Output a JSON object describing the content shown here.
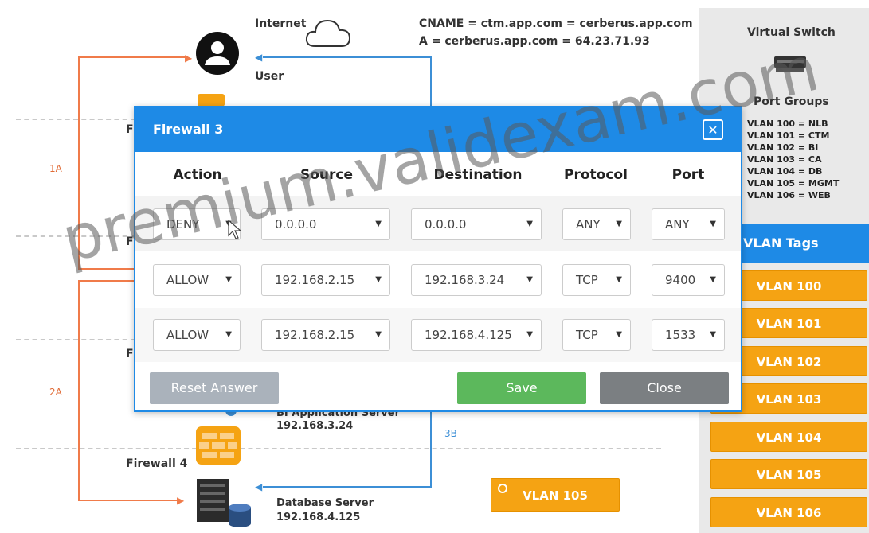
{
  "diagram": {
    "internet_label": "Internet",
    "user_label": "User",
    "cname_line": "CNAME = ctm.app.com = cerberus.app.com",
    "a_line": "A = cerberus.app.com = 64.23.71.93",
    "left_labels": [
      "1A",
      "2A"
    ],
    "partial_fw": [
      "F",
      "F",
      "F"
    ],
    "bi_server_name": "BI Application Server",
    "bi_server_ip": "192.168.3.24",
    "label_3b": "3B",
    "firewall4_label": "Firewall 4",
    "db_server_name": "Database Server",
    "db_server_ip": "192.168.4.125",
    "vlan105_chip": "VLAN 105"
  },
  "right_panel": {
    "title": "Virtual Switch",
    "port_groups_title": "Port Groups",
    "port_groups": [
      "VLAN 100 = NLB",
      "VLAN 101 = CTM",
      "VLAN 102 = BI",
      "VLAN 103 = CA",
      "VLAN 104 = DB",
      "VLAN 105 = MGMT",
      "VLAN 106 = WEB"
    ],
    "tags_header": "VLAN Tags",
    "tags": [
      "VLAN 100",
      "VLAN 101",
      "VLAN 102",
      "VLAN 103",
      "VLAN 104",
      "VLAN 105",
      "VLAN 106"
    ]
  },
  "modal": {
    "title": "Firewall 3",
    "close_x": "✕",
    "columns": [
      "Action",
      "Source",
      "Destination",
      "Protocol",
      "Port"
    ],
    "rows": [
      {
        "action": "DENY",
        "source": "0.0.0.0",
        "destination": "0.0.0.0",
        "protocol": "ANY",
        "port": "ANY"
      },
      {
        "action": "ALLOW",
        "source": "192.168.2.15",
        "destination": "192.168.3.24",
        "protocol": "TCP",
        "port": "9400"
      },
      {
        "action": "ALLOW",
        "source": "192.168.2.15",
        "destination": "192.168.4.125",
        "protocol": "TCP",
        "port": "1533"
      }
    ],
    "reset_label": "Reset Answer",
    "save_label": "Save",
    "close_label": "Close"
  },
  "colors": {
    "accent_blue": "#1e8ae6",
    "vlan_orange": "#f5a313",
    "save_green": "#5cb85c",
    "close_gray": "#7b7f82",
    "reset_gray": "#aab2bb"
  },
  "watermark": "premium.validexam.com"
}
